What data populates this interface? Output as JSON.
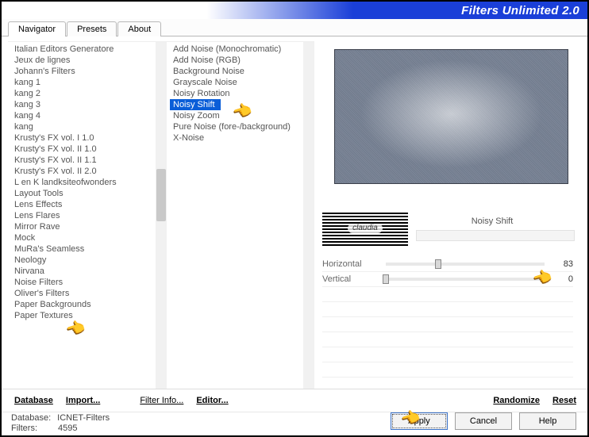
{
  "header": {
    "title": "Filters Unlimited 2.0"
  },
  "tabs": [
    "Navigator",
    "Presets",
    "About"
  ],
  "categories": {
    "selected_index": 19,
    "items": [
      "Italian Editors Generatore",
      "Jeux de lignes",
      "Johann's Filters",
      "kang 1",
      "kang 2",
      "kang 3",
      "kang 4",
      "kang",
      "Krusty's FX vol. I 1.0",
      "Krusty's FX vol. II 1.0",
      "Krusty's FX vol. II 1.1",
      "Krusty's FX vol. II 2.0",
      "L en K landksiteofwonders",
      "Layout Tools",
      "Lens Effects",
      "Lens Flares",
      "Mirror Rave",
      "Mock",
      "MuRa's Seamless",
      "Neology",
      "Nirvana",
      "Noise Filters",
      "Oliver's Filters",
      "Paper Backgrounds",
      "Paper Textures"
    ]
  },
  "filters": {
    "selected_index": 5,
    "items": [
      "Add Noise (Monochromatic)",
      "Add Noise (RGB)",
      "Background Noise",
      "Grayscale Noise",
      "Noisy Rotation",
      "Noisy Shift",
      "Noisy Zoom",
      "Pure Noise (fore-/background)",
      "X-Noise"
    ]
  },
  "preview": {
    "filter_name": "Noisy Shift",
    "author_stamp": "claudia"
  },
  "params": [
    {
      "label": "Horizontal",
      "value": 83
    },
    {
      "label": "Vertical",
      "value": 0
    }
  ],
  "toolbar": {
    "database": "Database",
    "import": "Import...",
    "filter_info": "Filter Info...",
    "editor": "Editor...",
    "randomize": "Randomize",
    "reset": "Reset"
  },
  "status": {
    "database_label": "Database:",
    "database_value": "ICNET-Filters",
    "filters_label": "Filters:",
    "filters_value": "4595"
  },
  "buttons": {
    "apply": "Apply",
    "cancel": "Cancel",
    "help": "Help"
  }
}
